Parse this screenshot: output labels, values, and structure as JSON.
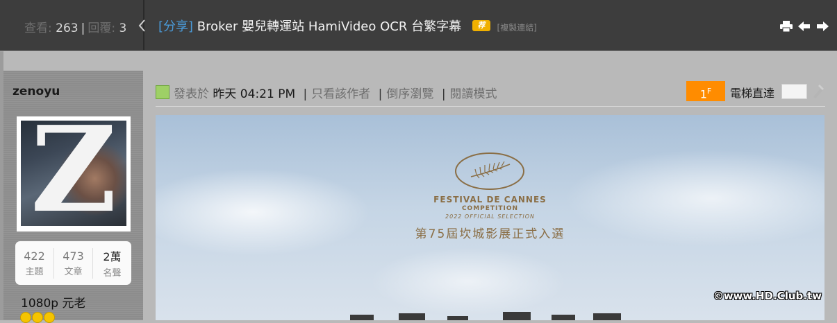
{
  "thread_header": {
    "views_label": "查看:",
    "views_value": "263",
    "separator": "|",
    "replies_label": "回覆:",
    "replies_value": "3",
    "category": "[分享]",
    "title": "Broker 嬰兒轉運站 HamiVideo OCR 台繁字幕",
    "badge": "荐",
    "copy_link": "[複製連結]",
    "icons": [
      "print-icon",
      "prev-thread-icon",
      "next-thread-icon"
    ]
  },
  "author": {
    "username": "zenoyu",
    "avatar_letter": "Z",
    "stats": [
      {
        "value": "422",
        "label": "主題"
      },
      {
        "value": "473",
        "label": "文章"
      },
      {
        "value": "2萬",
        "label": "名聲"
      }
    ],
    "rank": "1080p 元老"
  },
  "post": {
    "posted_label": "發表於",
    "posted_time": "昨天 04:21 PM",
    "bar": "|",
    "only_author": "只看該作者",
    "reverse": "倒序瀏覽",
    "read_mode": "閱讀模式",
    "floor_number": "1",
    "floor_suffix": "F",
    "elevator_label": "電梯直達"
  },
  "poster": {
    "line1": "FESTIVAL DE CANNES",
    "line2": "COMPETITION",
    "line3": "2022 OFFICIAL SELECTION",
    "line4": "第75屆坎城影展正式入選",
    "watermark": "©www.HD.Club.tw"
  },
  "colors": {
    "topbar": "#3d3d3d",
    "accent_link": "#4a9ad8",
    "floor_badge": "#ff8c00",
    "cannes_gold": "#8a6e45"
  }
}
